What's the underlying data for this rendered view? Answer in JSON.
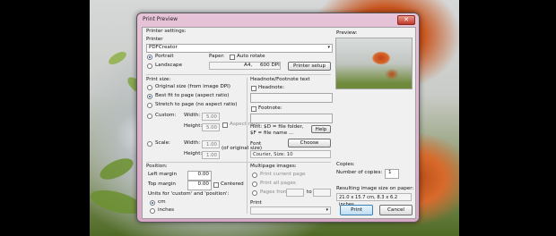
{
  "window": {
    "title": "Print Preview",
    "close_glyph": "✕"
  },
  "printer_settings": {
    "section_label": "Printer settings:",
    "printer_label": "Printer",
    "printer_value": "PDFCreator",
    "orientation": {
      "portrait": "Portrait",
      "landscape": "Landscape",
      "selected": "Portrait"
    },
    "paper_label": "Paper:",
    "paper_size": "A4,",
    "paper_dpi": "600 DPI",
    "auto_rotate": "Auto rotate",
    "setup_button": "Printer setup"
  },
  "preview": {
    "label": "Preview:"
  },
  "print_size": {
    "section_label": "Print size:",
    "options": [
      "Original size (from image DPI)",
      "Best fit to page (aspect ratio)",
      "Stretch to page (no aspect ratio)"
    ],
    "selected_index": 1,
    "custom_label": "Custom:",
    "width_label": "Width:",
    "height_label": "Height:",
    "custom_width": "5.00",
    "custom_height": "5.00",
    "aspect_ratio": "Aspect ratio",
    "scale_label": "Scale:",
    "scale_width": "1.00",
    "scale_height": "1.00",
    "of_original": "(of original size)"
  },
  "headnote": {
    "section_label": "Headnote/Footnote text",
    "headnote_label": "Headnote:",
    "footnote_label": "Footnote:",
    "hint": "Hint: $D = file folder,\n$F = file name ...",
    "help_button": "Help",
    "font_label": "Font",
    "choose_button": "Choose",
    "font_value": "Courier, Size: 10"
  },
  "position": {
    "section_label": "Position:",
    "left_margin_label": "Left margin",
    "left_margin": "0.00",
    "top_margin_label": "Top margin",
    "top_margin": "0.00",
    "centered": "Centered",
    "units_label": "Units for 'custom' and 'position':",
    "unit_cm": "cm",
    "unit_inches": "inches",
    "selected_unit": "cm"
  },
  "multipage": {
    "section_label": "Multipage images:",
    "options": [
      "Print current page",
      "Print all pages",
      "Pages from:"
    ],
    "to_label": "to",
    "print_label": "Print"
  },
  "copies": {
    "section_label": "Copies:",
    "number_label": "Number of copies:",
    "value": "1"
  },
  "result": {
    "label": "Resulting image size on paper:",
    "value": "21.0 x 15.7 cm, 8.3 x 6.2 inches"
  },
  "actions": {
    "print": "Print",
    "cancel": "Cancel"
  }
}
